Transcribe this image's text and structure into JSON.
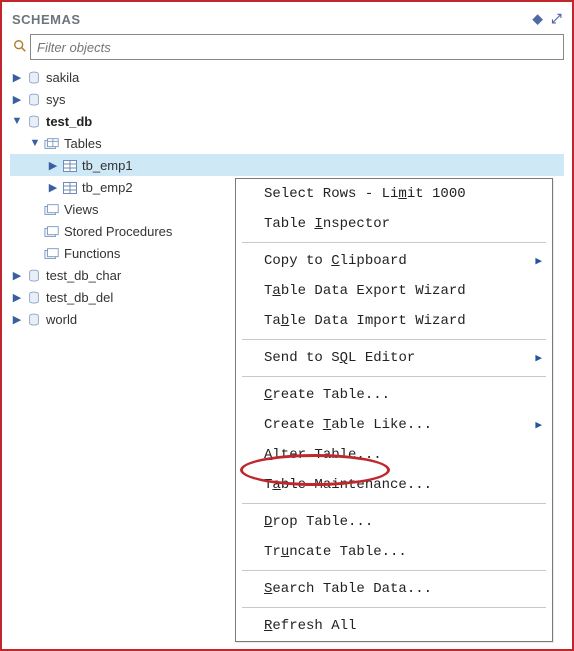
{
  "header": {
    "title": "SCHEMAS"
  },
  "search": {
    "placeholder": "Filter objects"
  },
  "tree": {
    "items": [
      {
        "label": "sakila"
      },
      {
        "label": "sys"
      },
      {
        "label": "test_db"
      },
      {
        "label": "Tables"
      },
      {
        "label": "tb_emp1"
      },
      {
        "label": "tb_emp2"
      },
      {
        "label": "Views"
      },
      {
        "label": "Stored Procedures"
      },
      {
        "label": "Functions"
      },
      {
        "label": "test_db_char"
      },
      {
        "label": "test_db_del"
      },
      {
        "label": "world"
      }
    ]
  },
  "context_menu": {
    "items": [
      {
        "label_pre": "Select Rows - Li",
        "u": "m",
        "label_post": "it 1000",
        "submenu": false
      },
      {
        "label_pre": "Table ",
        "u": "I",
        "label_post": "nspector",
        "submenu": false
      },
      {
        "sep": true
      },
      {
        "label_pre": "Copy to ",
        "u": "C",
        "label_post": "lipboard",
        "submenu": true
      },
      {
        "label_pre": "T",
        "u": "a",
        "label_post": "ble Data Export Wizard",
        "submenu": false
      },
      {
        "label_pre": "Ta",
        "u": "b",
        "label_post": "le Data Import Wizard",
        "submenu": false
      },
      {
        "sep": true
      },
      {
        "label_pre": "Send to S",
        "u": "Q",
        "label_post": "L Editor",
        "submenu": true
      },
      {
        "sep": true
      },
      {
        "u": "C",
        "label_post": "reate Table...",
        "submenu": false
      },
      {
        "label_pre": "Create ",
        "u": "T",
        "label_post": "able Like...",
        "submenu": true
      },
      {
        "u": "A",
        "label_post": "lter Table...",
        "submenu": false,
        "highlight": true
      },
      {
        "label_pre": "T",
        "u": "a",
        "label_post": "ble Maintenance...",
        "submenu": false
      },
      {
        "sep": true
      },
      {
        "u": "D",
        "label_post": "rop Table...",
        "submenu": false
      },
      {
        "label_pre": "Tr",
        "u": "u",
        "label_post": "ncate Table...",
        "submenu": false
      },
      {
        "sep": true
      },
      {
        "u": "S",
        "label_post": "earch Table Data...",
        "submenu": false
      },
      {
        "sep": true
      },
      {
        "u": "R",
        "label_post": "efresh All",
        "submenu": false
      }
    ]
  }
}
